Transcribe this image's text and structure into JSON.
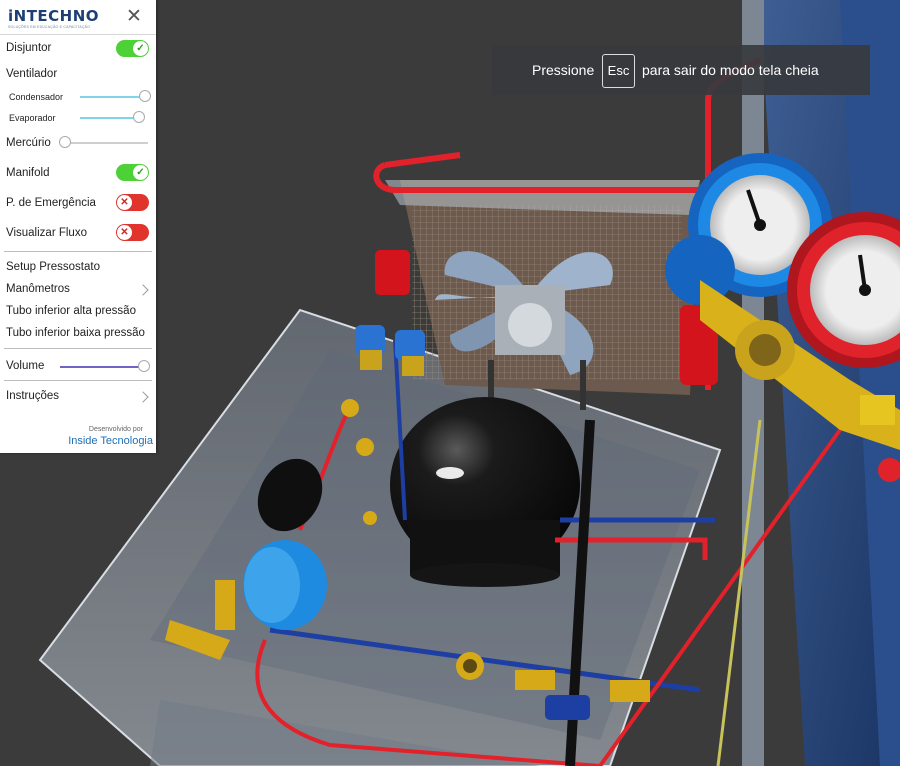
{
  "panel": {
    "logo": "iNTECHNO",
    "logo_sub": "SOLUÇÕES EM EDUCAÇÃO E CAPACITAÇÃO",
    "close_symbol": "✕",
    "items": {
      "disjuntor": {
        "label": "Disjuntor",
        "state": "on"
      },
      "ventilador": {
        "label": "Ventilador"
      },
      "condensador": {
        "label": "Condensador",
        "level": 1.0
      },
      "evaporador": {
        "label": "Evaporador",
        "level": 0.9
      },
      "mercurio": {
        "label": "Mercúrio",
        "level": 0.0
      },
      "manifold": {
        "label": "Manifold",
        "state": "on"
      },
      "emergencia": {
        "label": "P. de Emergência",
        "state": "off"
      },
      "fluxo": {
        "label": "Visualizar Fluxo",
        "state": "off"
      },
      "setup": {
        "label": "Setup Pressostato"
      },
      "manometros": {
        "label": "Manômetros"
      },
      "tubo_alta": {
        "label": "Tubo inferior alta pressão"
      },
      "tubo_baixa": {
        "label": "Tubo inferior baixa pressão"
      },
      "volume": {
        "label": "Volume",
        "level": 1.0
      },
      "instrucoes": {
        "label": "Instruções"
      }
    },
    "toggle_on_glyph": "✓",
    "toggle_off_glyph": "✕",
    "credit_line1": "Desenvolvido por",
    "credit_line2": "Inside Tecnologia"
  },
  "toast": {
    "before": "Pressione",
    "key": "Esc",
    "after": "para sair do modo tela cheia"
  },
  "colors": {
    "toggle_on": "#4cd137",
    "toggle_off": "#e0342c",
    "slider_fill": "#80d4ec",
    "volume_fill": "#6d64c4",
    "brand": "#1d3f73",
    "link": "#1f6fb5"
  },
  "icons": {
    "close": "close-icon",
    "check": "check-icon",
    "chevron": "chevron-right-icon"
  }
}
